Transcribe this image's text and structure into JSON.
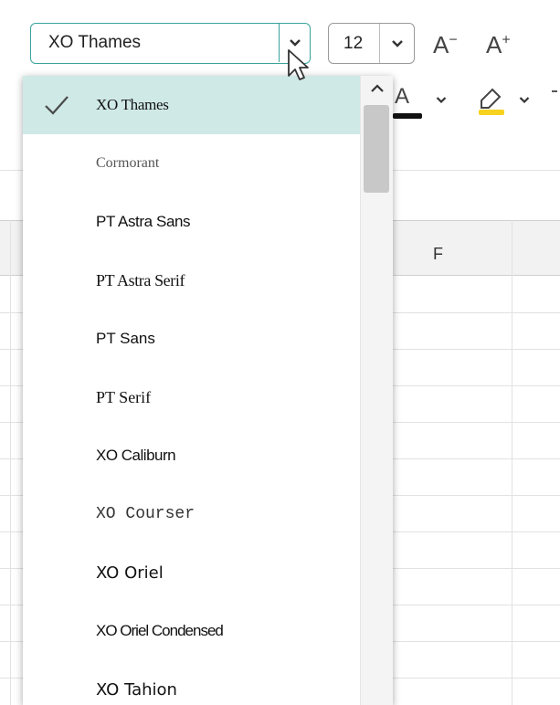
{
  "toolbar": {
    "font_name": "XO Thames",
    "font_size": "12",
    "decrease_font_label": "A",
    "decrease_font_sup": "−",
    "increase_font_label": "A",
    "increase_font_sup": "+",
    "font_color_label": "A",
    "font_color": "#111111",
    "highlight_color": "#f7d21e"
  },
  "sheet": {
    "column_header": "F"
  },
  "dropdown": {
    "items": [
      {
        "label": "XO Thames",
        "selected": true
      },
      {
        "label": "Cormorant"
      },
      {
        "label": "PT Astra Sans"
      },
      {
        "label": "PT Astra Serif"
      },
      {
        "label": "PT Sans"
      },
      {
        "label": "PT Serif"
      },
      {
        "label": "XO Caliburn"
      },
      {
        "label": "XO Courser"
      },
      {
        "label": "XO Oriel"
      },
      {
        "label": "XO Oriel Condensed"
      },
      {
        "label": "XO Tahion"
      }
    ]
  },
  "colors": {
    "accent": "#3aa39b",
    "selected_bg": "#cfe9e6"
  }
}
